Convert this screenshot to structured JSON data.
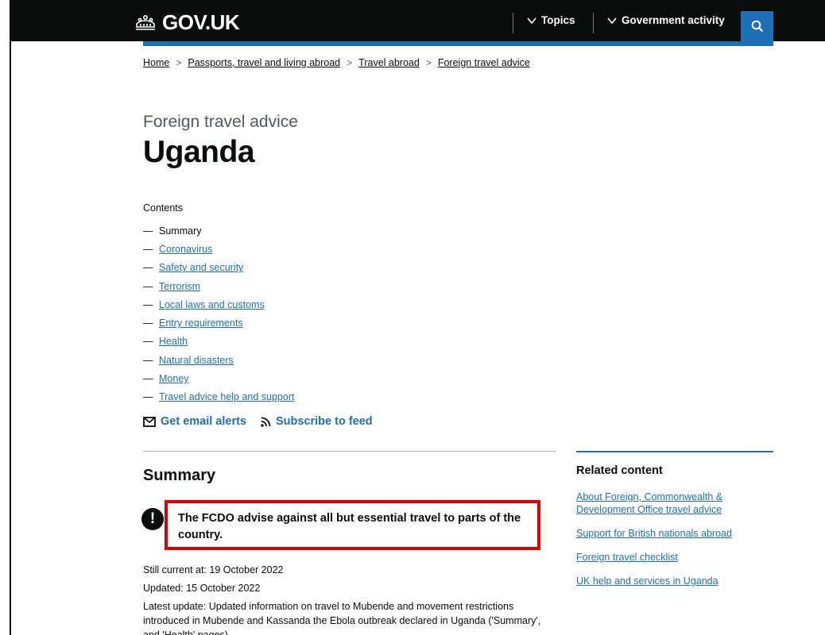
{
  "header": {
    "logo_text": "GOV.UK",
    "nav": [
      {
        "label": "Topics"
      },
      {
        "label": "Government activity"
      }
    ],
    "search_icon": "search-icon"
  },
  "breadcrumb": [
    "Home",
    "Passports, travel and living abroad",
    "Travel abroad",
    "Foreign travel advice"
  ],
  "page": {
    "caption": "Foreign travel advice",
    "title": "Uganda"
  },
  "contents": {
    "heading": "Contents",
    "items": [
      {
        "label": "Summary"
      },
      {
        "label": "Coronavirus"
      },
      {
        "label": "Safety and security"
      },
      {
        "label": "Terrorism"
      },
      {
        "label": "Local laws and customs"
      },
      {
        "label": "Entry requirements"
      },
      {
        "label": "Health"
      },
      {
        "label": "Natural disasters"
      },
      {
        "label": "Money"
      },
      {
        "label": "Travel advice help and support"
      }
    ]
  },
  "alerts": {
    "email_label": "Get email alerts",
    "feed_label": "Subscribe to feed"
  },
  "summary": {
    "heading": "Summary",
    "warning_text": "The FCDO advise against all but essential travel to parts of the country.",
    "still_current": "Still current at: 19 October 2022",
    "updated": "Updated: 15 October 2022",
    "latest_update": "Latest update: Updated information on travel to Mubende and movement restrictions introduced in Mubende and Kassanda the Ebola outbreak declared in Uganda ('Summary', and 'Health' pages)"
  },
  "related": {
    "heading": "Related content",
    "links": [
      {
        "label": "About Foreign, Commonwealth & Development Office travel advice"
      },
      {
        "label": "Support for British nationals abroad"
      },
      {
        "label": "Foreign travel checklist"
      },
      {
        "label": "UK help and services in Uganda"
      }
    ]
  },
  "colors": {
    "header_bg": "#0b0c0c",
    "link": "#1d70b8",
    "highlight_border": "#e00000"
  }
}
